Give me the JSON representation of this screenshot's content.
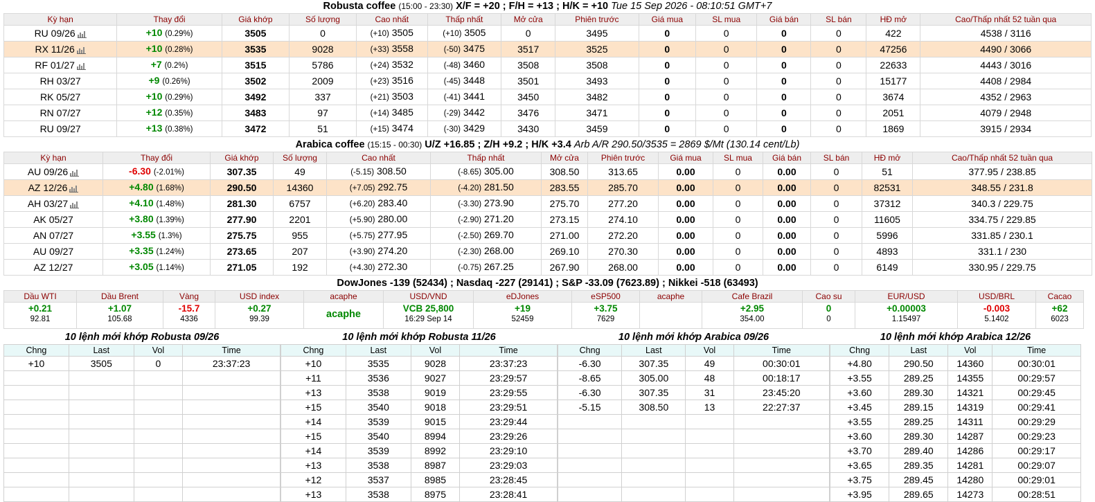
{
  "robusta": {
    "name": "Robusta coffee",
    "hours": "(15:00 - 23:30)",
    "spreads": "X/F = +20 ; F/H = +13 ; H/K = +10",
    "datetime": "Tue 15 Sep 2026 - 08:10:51 GMT+7",
    "headers": [
      "Kỳ hạn",
      "Thay đổi",
      "Giá khớp",
      "Số lượng",
      "Cao nhất",
      "Thấp nhất",
      "Mở cửa",
      "Phiên trước",
      "Giá mua",
      "SL mua",
      "Giá bán",
      "SL bán",
      "HĐ mở",
      "Cao/Thấp nhất 52 tuần qua"
    ],
    "rows": [
      {
        "term": "RU 09/26",
        "chart": true,
        "change": "+10",
        "pct": "(0.29%)",
        "dir": "up",
        "price": "3505",
        "volume": "0",
        "high_chg": "(+10)",
        "high": "3505",
        "low_chg": "(+10)",
        "low": "3505",
        "open": "0",
        "prev": "3495",
        "bid": "0",
        "bid_qty": "0",
        "ask": "0",
        "ask_qty": "0",
        "oi": "422",
        "range52": "4538 / 3116",
        "highlight": false
      },
      {
        "term": "RX 11/26",
        "chart": true,
        "change": "+10",
        "pct": "(0.28%)",
        "dir": "up",
        "price": "3535",
        "volume": "9028",
        "high_chg": "(+33)",
        "high": "3558",
        "low_chg": "(-50)",
        "low": "3475",
        "open": "3517",
        "prev": "3525",
        "bid": "0",
        "bid_qty": "0",
        "ask": "0",
        "ask_qty": "0",
        "oi": "47256",
        "range52": "4490 / 3066",
        "highlight": true
      },
      {
        "term": "RF 01/27",
        "chart": true,
        "change": "+7",
        "pct": "(0.2%)",
        "dir": "up",
        "price": "3515",
        "volume": "5786",
        "high_chg": "(+24)",
        "high": "3532",
        "low_chg": "(-48)",
        "low": "3460",
        "open": "3508",
        "prev": "3508",
        "bid": "0",
        "bid_qty": "0",
        "ask": "0",
        "ask_qty": "0",
        "oi": "22633",
        "range52": "4443 / 3016",
        "highlight": false
      },
      {
        "term": "RH 03/27",
        "chart": false,
        "change": "+9",
        "pct": "(0.26%)",
        "dir": "up",
        "price": "3502",
        "volume": "2009",
        "high_chg": "(+23)",
        "high": "3516",
        "low_chg": "(-45)",
        "low": "3448",
        "open": "3501",
        "prev": "3493",
        "bid": "0",
        "bid_qty": "0",
        "ask": "0",
        "ask_qty": "0",
        "oi": "15177",
        "range52": "4408 / 2984",
        "highlight": false
      },
      {
        "term": "RK 05/27",
        "chart": false,
        "change": "+10",
        "pct": "(0.29%)",
        "dir": "up",
        "price": "3492",
        "volume": "337",
        "high_chg": "(+21)",
        "high": "3503",
        "low_chg": "(-41)",
        "low": "3441",
        "open": "3450",
        "prev": "3482",
        "bid": "0",
        "bid_qty": "0",
        "ask": "0",
        "ask_qty": "0",
        "oi": "3674",
        "range52": "4352 / 2963",
        "highlight": false
      },
      {
        "term": "RN 07/27",
        "chart": false,
        "change": "+12",
        "pct": "(0.35%)",
        "dir": "up",
        "price": "3483",
        "volume": "97",
        "high_chg": "(+14)",
        "high": "3485",
        "low_chg": "(-29)",
        "low": "3442",
        "open": "3476",
        "prev": "3471",
        "bid": "0",
        "bid_qty": "0",
        "ask": "0",
        "ask_qty": "0",
        "oi": "2051",
        "range52": "4079 / 2948",
        "highlight": false
      },
      {
        "term": "RU 09/27",
        "chart": false,
        "change": "+13",
        "pct": "(0.38%)",
        "dir": "up",
        "price": "3472",
        "volume": "51",
        "high_chg": "(+15)",
        "high": "3474",
        "low_chg": "(-30)",
        "low": "3429",
        "open": "3430",
        "prev": "3459",
        "bid": "0",
        "bid_qty": "0",
        "ask": "0",
        "ask_qty": "0",
        "oi": "1869",
        "range52": "3915 / 2934",
        "highlight": false
      }
    ]
  },
  "arabica": {
    "name": "Arabica coffee",
    "hours": "(15:15 - 00:30)",
    "spreads": "U/Z +16.85 ; Z/H +9.2 ; H/K +3.4",
    "arb": "Arb A/R 290.50/3535 = 2869 $/Mt (130.14 cent/Lb)",
    "headers": [
      "Kỳ hạn",
      "Thay đổi",
      "Giá khớp",
      "Số lượng",
      "Cao nhất",
      "Thấp nhất",
      "Mở cửa",
      "Phiên trước",
      "Giá mua",
      "SL mua",
      "Giá bán",
      "SL bán",
      "HĐ mở",
      "Cao/Thấp nhất 52 tuần qua"
    ],
    "rows": [
      {
        "term": "AU 09/26",
        "chart": true,
        "change": "-6.30",
        "pct": "(-2.01%)",
        "dir": "down",
        "price": "307.35",
        "volume": "49",
        "high_chg": "(-5.15)",
        "high": "308.50",
        "low_chg": "(-8.65)",
        "low": "305.00",
        "open": "308.50",
        "prev": "313.65",
        "bid": "0.00",
        "bid_qty": "0",
        "ask": "0.00",
        "ask_qty": "0",
        "oi": "51",
        "range52": "377.95 / 238.85",
        "highlight": false
      },
      {
        "term": "AZ 12/26",
        "chart": true,
        "change": "+4.80",
        "pct": "(1.68%)",
        "dir": "up",
        "price": "290.50",
        "volume": "14360",
        "high_chg": "(+7.05)",
        "high": "292.75",
        "low_chg": "(-4.20)",
        "low": "281.50",
        "open": "283.55",
        "prev": "285.70",
        "bid": "0.00",
        "bid_qty": "0",
        "ask": "0.00",
        "ask_qty": "0",
        "oi": "82531",
        "range52": "348.55 / 231.8",
        "highlight": true
      },
      {
        "term": "AH 03/27",
        "chart": true,
        "change": "+4.10",
        "pct": "(1.48%)",
        "dir": "up",
        "price": "281.30",
        "volume": "6757",
        "high_chg": "(+6.20)",
        "high": "283.40",
        "low_chg": "(-3.30)",
        "low": "273.90",
        "open": "275.70",
        "prev": "277.20",
        "bid": "0.00",
        "bid_qty": "0",
        "ask": "0.00",
        "ask_qty": "0",
        "oi": "37312",
        "range52": "340.3 / 229.75",
        "highlight": false
      },
      {
        "term": "AK 05/27",
        "chart": false,
        "change": "+3.80",
        "pct": "(1.39%)",
        "dir": "up",
        "price": "277.90",
        "volume": "2201",
        "high_chg": "(+5.90)",
        "high": "280.00",
        "low_chg": "(-2.90)",
        "low": "271.20",
        "open": "273.15",
        "prev": "274.10",
        "bid": "0.00",
        "bid_qty": "0",
        "ask": "0.00",
        "ask_qty": "0",
        "oi": "11605",
        "range52": "334.75 / 229.85",
        "highlight": false
      },
      {
        "term": "AN 07/27",
        "chart": false,
        "change": "+3.55",
        "pct": "(1.3%)",
        "dir": "up",
        "price": "275.75",
        "volume": "955",
        "high_chg": "(+5.75)",
        "high": "277.95",
        "low_chg": "(-2.50)",
        "low": "269.70",
        "open": "271.00",
        "prev": "272.20",
        "bid": "0.00",
        "bid_qty": "0",
        "ask": "0.00",
        "ask_qty": "0",
        "oi": "5996",
        "range52": "331.85 / 230.1",
        "highlight": false
      },
      {
        "term": "AU 09/27",
        "chart": false,
        "change": "+3.35",
        "pct": "(1.24%)",
        "dir": "up",
        "price": "273.65",
        "volume": "207",
        "high_chg": "(+3.90)",
        "high": "274.20",
        "low_chg": "(-2.30)",
        "low": "268.00",
        "open": "269.10",
        "prev": "270.30",
        "bid": "0.00",
        "bid_qty": "0",
        "ask": "0.00",
        "ask_qty": "0",
        "oi": "4893",
        "range52": "331.1 / 230",
        "highlight": false
      },
      {
        "term": "AZ 12/27",
        "chart": false,
        "change": "+3.05",
        "pct": "(1.14%)",
        "dir": "up",
        "price": "271.05",
        "volume": "192",
        "high_chg": "(+4.30)",
        "high": "272.30",
        "low_chg": "(-0.75)",
        "low": "267.25",
        "open": "267.90",
        "prev": "268.00",
        "bid": "0.00",
        "bid_qty": "0",
        "ask": "0.00",
        "ask_qty": "0",
        "oi": "6149",
        "range52": "330.95 / 229.75",
        "highlight": false
      }
    ]
  },
  "indices_line": "DowJones -139 (52434) ; Nasdaq -227 (29141) ; S&P -33.09 (7623.89) ; Nikkei -518 (63493)",
  "markets": [
    {
      "label": "Dầu WTI",
      "v1": "+0.21",
      "dir": "up",
      "v2": "92.81"
    },
    {
      "label": "Dầu Brent",
      "v1": "+1.07",
      "dir": "up",
      "v2": "105.68"
    },
    {
      "label": "Vàng",
      "v1": "-15.7",
      "dir": "down",
      "v2": "4336"
    },
    {
      "label": "USD index",
      "v1": "+0.27",
      "dir": "up",
      "v2": "99.39"
    },
    {
      "label": "acaphe",
      "v1": "acaphe",
      "dir": "up",
      "v2": "",
      "brand": true
    },
    {
      "label": "USD/VND",
      "v1": "VCB 25,800",
      "dir": "up",
      "v2": "16:29 Sep 14"
    },
    {
      "label": "eDJones",
      "v1": "+19",
      "dir": "up",
      "v2": "52459"
    },
    {
      "label": "eSP500",
      "v1": "+3.75",
      "dir": "up",
      "v2": "7629"
    },
    {
      "label": "acaphe",
      "v1": "",
      "dir": "up",
      "v2": ""
    },
    {
      "label": "Cafe Brazil",
      "v1": "+2.95",
      "dir": "up",
      "v2": "354.00"
    },
    {
      "label": "Cao su",
      "v1": "0",
      "dir": "up",
      "v2": "0"
    },
    {
      "label": "EUR/USD",
      "v1": "+0.00003",
      "dir": "up",
      "v2": "1.15497"
    },
    {
      "label": "USD/BRL",
      "v1": "-0.003",
      "dir": "down",
      "v2": "5.1402"
    },
    {
      "label": "Cacao",
      "v1": "+62",
      "dir": "up",
      "v2": "6023"
    }
  ],
  "trades": [
    {
      "title": "10 lệnh mới khớp Robusta 09/26",
      "headers": [
        "Chng",
        "Last",
        "Vol",
        "Time"
      ],
      "rows": [
        [
          "+10",
          "3505",
          "0",
          "23:37:23"
        ]
      ]
    },
    {
      "title": "10 lệnh mới khớp Robusta 11/26",
      "headers": [
        "Chng",
        "Last",
        "Vol",
        "Time"
      ],
      "rows": [
        [
          "+10",
          "3535",
          "9028",
          "23:37:23"
        ],
        [
          "+11",
          "3536",
          "9027",
          "23:29:57"
        ],
        [
          "+13",
          "3538",
          "9019",
          "23:29:55"
        ],
        [
          "+15",
          "3540",
          "9018",
          "23:29:51"
        ],
        [
          "+14",
          "3539",
          "9015",
          "23:29:44"
        ],
        [
          "+15",
          "3540",
          "8994",
          "23:29:26"
        ],
        [
          "+14",
          "3539",
          "8992",
          "23:29:10"
        ],
        [
          "+13",
          "3538",
          "8987",
          "23:29:03"
        ],
        [
          "+12",
          "3537",
          "8985",
          "23:28:45"
        ],
        [
          "+13",
          "3538",
          "8975",
          "23:28:41"
        ]
      ]
    },
    {
      "title": "10 lệnh mới khớp Arabica 09/26",
      "headers": [
        "Chng",
        "Last",
        "Vol",
        "Time"
      ],
      "rows": [
        [
          "-6.30",
          "307.35",
          "49",
          "00:30:01"
        ],
        [
          "-8.65",
          "305.00",
          "48",
          "00:18:17"
        ],
        [
          "-6.30",
          "307.35",
          "31",
          "23:45:20"
        ],
        [
          "-5.15",
          "308.50",
          "13",
          "22:27:37"
        ]
      ]
    },
    {
      "title": "10 lệnh mới khớp Arabica 12/26",
      "headers": [
        "Chng",
        "Last",
        "Vol",
        "Time"
      ],
      "rows": [
        [
          "+4.80",
          "290.50",
          "14360",
          "00:30:01"
        ],
        [
          "+3.55",
          "289.25",
          "14355",
          "00:29:57"
        ],
        [
          "+3.60",
          "289.30",
          "14321",
          "00:29:45"
        ],
        [
          "+3.45",
          "289.15",
          "14319",
          "00:29:41"
        ],
        [
          "+3.55",
          "289.25",
          "14311",
          "00:29:29"
        ],
        [
          "+3.60",
          "289.30",
          "14287",
          "00:29:23"
        ],
        [
          "+3.70",
          "289.40",
          "14286",
          "00:29:17"
        ],
        [
          "+3.65",
          "289.35",
          "14281",
          "00:29:07"
        ],
        [
          "+3.75",
          "289.45",
          "14280",
          "00:29:01"
        ],
        [
          "+3.95",
          "289.65",
          "14273",
          "00:28:51"
        ]
      ]
    }
  ],
  "colors": {
    "up": "#008800",
    "down": "#e00000",
    "header_text": "#8b0000",
    "highlight_row": "#fde3c8",
    "trade_header_bg": "#e8f8f8"
  },
  "icons": {
    "chart": "bar-chart-icon"
  }
}
